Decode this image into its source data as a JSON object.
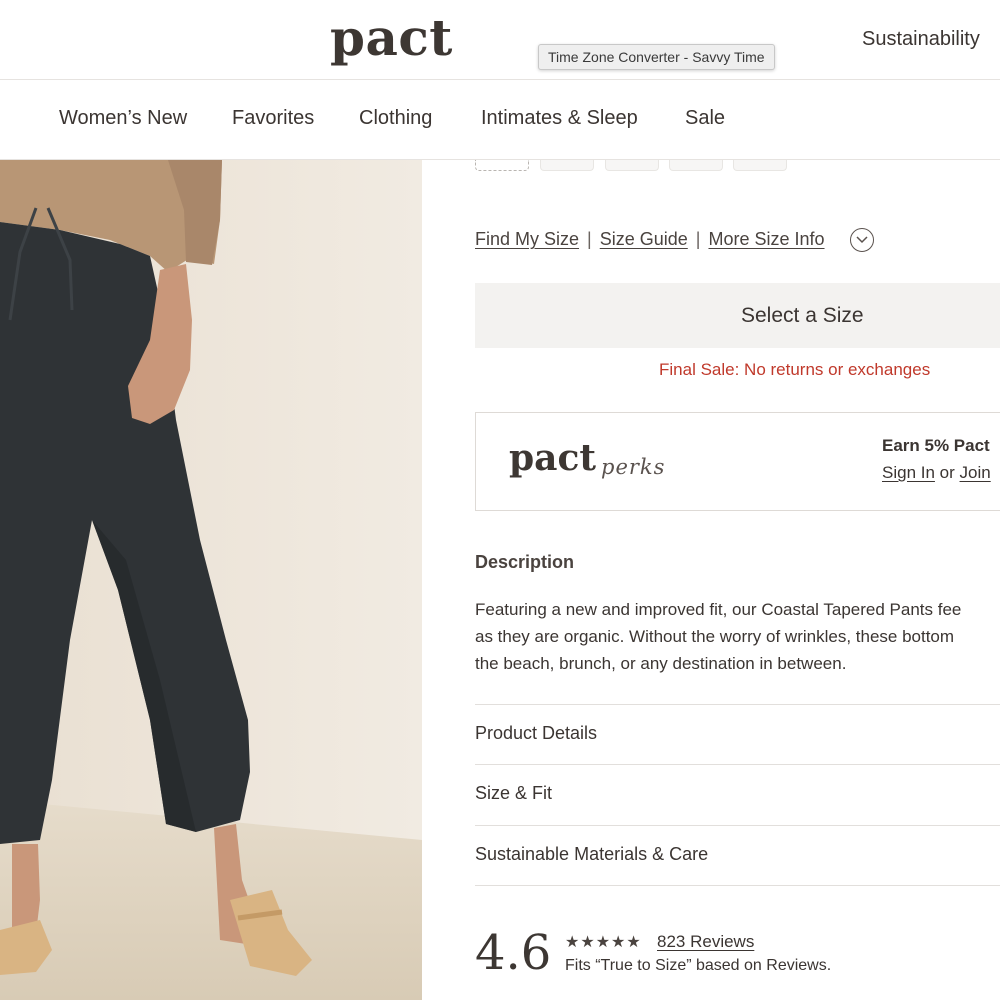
{
  "header": {
    "logo": "pact",
    "tooltip": "Time Zone Converter - Savvy Time",
    "top_link": "Sustainability"
  },
  "nav": {
    "items": [
      {
        "label": "Women’s New"
      },
      {
        "label": "Favorites"
      },
      {
        "label": "Clothing"
      },
      {
        "label": "Intimates & Sleep"
      },
      {
        "label": "Sale"
      }
    ]
  },
  "product": {
    "image_alt": "Model wearing black crinkle tapered pants with tan sweater and sandals"
  },
  "size": {
    "links": [
      "Find My Size",
      "Size Guide",
      "More Size Info"
    ],
    "separator": "|",
    "select_label": "Select a Size",
    "final_sale": "Final Sale: No returns or exchanges"
  },
  "perks": {
    "logo": "pact",
    "logo_sub": "perks",
    "earn_text": "Earn 5% Pact",
    "sign_in": "Sign In",
    "or_text": "or",
    "join": "Join"
  },
  "description": {
    "title": "Description",
    "lines": [
      "Featuring a new and improved fit, our Coastal Tapered Pants fee",
      "as they are organic. Without the worry of wrinkles, these bottom",
      "the beach, brunch, or any destination in between."
    ]
  },
  "accordion": [
    {
      "label": "Product Details"
    },
    {
      "label": "Size & Fit"
    },
    {
      "label": "Sustainable Materials & Care"
    }
  ],
  "reviews": {
    "rating": "4.6",
    "stars": "★★★★★",
    "count_label": "823 Reviews",
    "fit_text": "Fits “True to Size” based on Reviews."
  },
  "colors": {
    "text": "#3b3532",
    "final_sale": "#c0392b",
    "button_bg": "#f3f2f0",
    "divider": "#e2dfdc"
  }
}
